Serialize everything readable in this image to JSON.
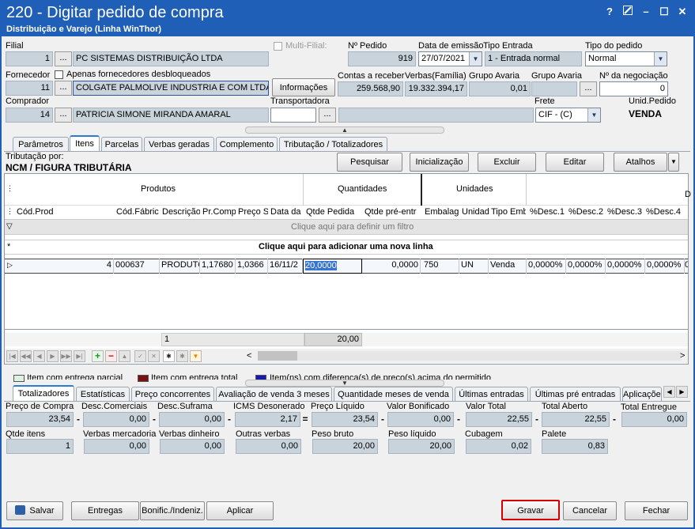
{
  "window": {
    "title": "220 - Digitar pedido de compra",
    "subtitle": "Distribuição e Varejo (Linha WinThor)",
    "controls": [
      "?",
      "",
      "–",
      "☐",
      "✕"
    ]
  },
  "header": {
    "filial_label": "Filial",
    "filial_code": "1",
    "filial_name": "PC SISTEMAS DISTRIBUIÇÃO LTDA",
    "multi_filial_label": "Multi-Filial:",
    "num_pedido_label": "Nº Pedido",
    "num_pedido": "919",
    "data_emissao_label": "Data de emissão",
    "data_emissao": "27/07/2021",
    "tipo_entrada_label": "Tipo Entrada",
    "tipo_entrada": "1 - Entrada normal",
    "tipo_pedido_label": "Tipo do pedido",
    "tipo_pedido": "Normal",
    "fornecedor_label": "Fornecedor",
    "apenas_label": "Apenas fornecedores desbloqueados",
    "fornecedor_code": "11",
    "fornecedor_name": "COLGATE PALMOLIVE INDUSTRIA  E COM LTDA",
    "informacoes_button": "Informações",
    "contas_receber_label": "Contas a receber",
    "contas_receber": "259.568,90",
    "verbas_label": "Verbas(Família)",
    "verbas": "19.332.394,17",
    "grupo_avaria_label1": "Grupo Avaria",
    "grupo_avaria_value": "0,01",
    "grupo_avaria_label2": "Grupo Avaria",
    "num_negociacao_label": "Nº da negociação",
    "num_negociacao": "0",
    "comprador_label": "Comprador",
    "comprador_code": "14",
    "comprador_name": "PATRICIA SIMONE MIRANDA AMARAL",
    "transportadora_label": "Transportadora",
    "frete_label": "Frete",
    "frete": "CIF - (C)",
    "unid_pedido_label": "Unid.Pedido",
    "unid_pedido": "VENDA",
    "ellipsis": "..."
  },
  "tabs": [
    "Parâmetros",
    "Itens",
    "Parcelas",
    "Verbas geradas",
    "Complemento",
    "Tributação / Totalizadores"
  ],
  "itens": {
    "tributacao_label": "Tributação por:",
    "tributacao_value": "NCM / FIGURA TRIBUTÁRIA",
    "buttons": [
      "Pesquisar",
      "Inicialização",
      "Excluir",
      "Editar",
      "Atalhos"
    ],
    "band_produtos": "Produtos",
    "band_quantidades": "Quantidades",
    "band_unidades": "Unidades",
    "columns": [
      "Cód.Prod",
      "Cód.Fábric",
      "Descrição",
      "Pr.Comp",
      "Preço S",
      "Data da",
      "Qtde Pedida",
      "Qtde pré-entr",
      "Embalage",
      "Unidad",
      "Tipo Emb",
      "%Desc.1",
      "%Desc.2",
      "%Desc.3",
      "%Desc.4",
      ""
    ],
    "filter_text": "Clique aqui para definir um filtro",
    "new_row_text": "Clique aqui para adicionar uma nova linha",
    "row": [
      "4",
      "000637",
      "PRODUTO",
      "1,17680",
      "1,0366",
      "16/11/2",
      "20,0000",
      "0,0000",
      "750",
      "UN",
      "Venda",
      "0,0000%",
      "0,0000%",
      "0,0000%",
      "0,0000%",
      "0"
    ],
    "footer_count": "1",
    "footer_qtde": "20,00"
  },
  "legend": [
    "Item com entrega parcial",
    "Item com entrega total",
    "Item(ns) com diferença(s) de preço(s) acima do permitido"
  ],
  "legend_colors": [
    "#e0f0e0",
    "#7a1010",
    "#1a1aaa"
  ],
  "bottom_tabs": [
    "Totalizadores",
    "Estatísticas",
    "Preço concorrentes",
    "Avaliação de venda 3 meses",
    "Quantidade meses de venda",
    "Últimas entradas",
    "Últimas pré entradas",
    "Aplicações"
  ],
  "totals_row1": {
    "labels": [
      "Preço de Compra",
      "Desc.Comerciais",
      "Desc.Suframa",
      "ICMS Desonerado",
      "Preço Líquido",
      "Valor Bonificado",
      "Valor Total",
      "Total Aberto",
      "Total Entregue"
    ],
    "values": [
      "23,54",
      "0,00",
      "0,00",
      "2,17",
      "23,54",
      "0,00",
      "22,55",
      "22,55",
      "0,00"
    ],
    "ops": [
      "-",
      "-",
      "-",
      "=",
      "-",
      "-",
      "-",
      "-"
    ]
  },
  "totals_row2": {
    "labels": [
      "Qtde itens",
      "Verbas mercadoria",
      "Verbas dinheiro",
      "Outras verbas",
      "Peso bruto",
      "Peso líquido",
      "Cubagem",
      "Palete"
    ],
    "values": [
      "1",
      "0,00",
      "0,00",
      "0,00",
      "20,00",
      "20,00",
      "0,02",
      "0,83"
    ]
  },
  "footer_buttons": {
    "salvar": "Salvar",
    "entregas": "Entregas",
    "bonific": "Bonific./Indeniz.",
    "aplicar": "Aplicar",
    "gravar": "Gravar",
    "cancelar": "Cancelar",
    "fechar": "Fechar"
  },
  "colors": {
    "titlebar": "#1f5fb7",
    "highlight": "#d40000"
  }
}
